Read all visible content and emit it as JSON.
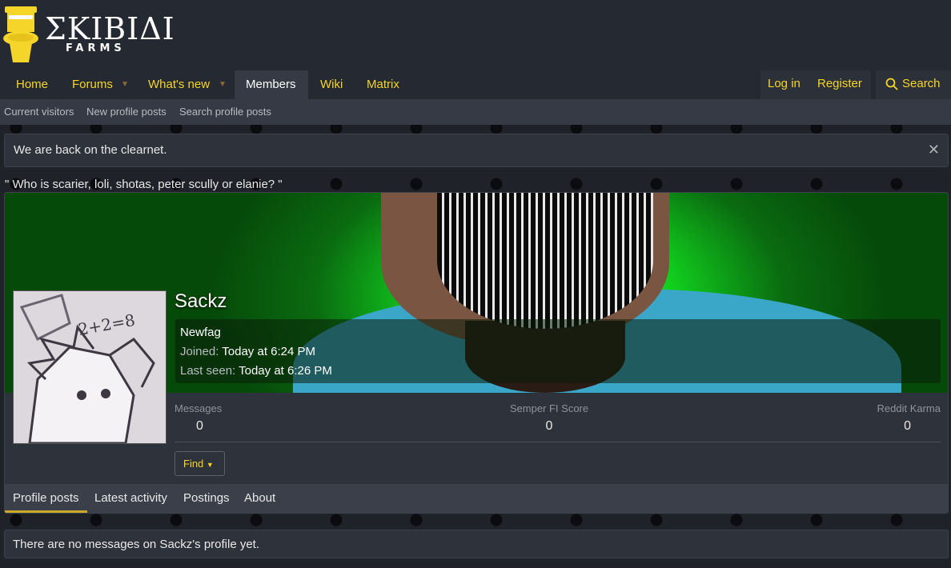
{
  "site": {
    "logo_text": "ΣΚΙΒΙΔΙ",
    "logo_subtext": "FARMS"
  },
  "nav": {
    "items": [
      {
        "label": "Home"
      },
      {
        "label": "Forums"
      },
      {
        "label": "What's new"
      },
      {
        "label": "Members"
      },
      {
        "label": "Wiki"
      },
      {
        "label": "Matrix"
      }
    ],
    "login": "Log in",
    "register": "Register",
    "search": "Search"
  },
  "subnav": {
    "items": [
      {
        "label": "Current visitors"
      },
      {
        "label": "New profile posts"
      },
      {
        "label": "Search profile posts"
      }
    ]
  },
  "notice": {
    "text": "We are back on the clearnet.",
    "close": "✕"
  },
  "quote": "\" Who is scarier, loli, shotas, peter scully or elanie? \"",
  "profile": {
    "username": "Sackz",
    "user_title": "Newfag",
    "joined_label": "Joined:",
    "joined_value": "Today at 6:24 PM",
    "last_seen_label": "Last seen:",
    "last_seen_value": "Today at 6:26 PM",
    "avatar_text": "2+2=8",
    "stats": [
      {
        "label": "Messages",
        "value": "0"
      },
      {
        "label": "Semper FI Score",
        "value": "0"
      },
      {
        "label": "Reddit Karma",
        "value": "0"
      }
    ],
    "find_label": "Find"
  },
  "tabs": [
    {
      "label": "Profile posts"
    },
    {
      "label": "Latest activity"
    },
    {
      "label": "Postings"
    },
    {
      "label": "About"
    }
  ],
  "empty_message": "There are no messages on Sackz's profile yet.",
  "colors": {
    "accent": "#f6d52a",
    "header_bg": "#252932",
    "panel_bg": "#2e323a",
    "tab_underline": "#c8a92a"
  }
}
